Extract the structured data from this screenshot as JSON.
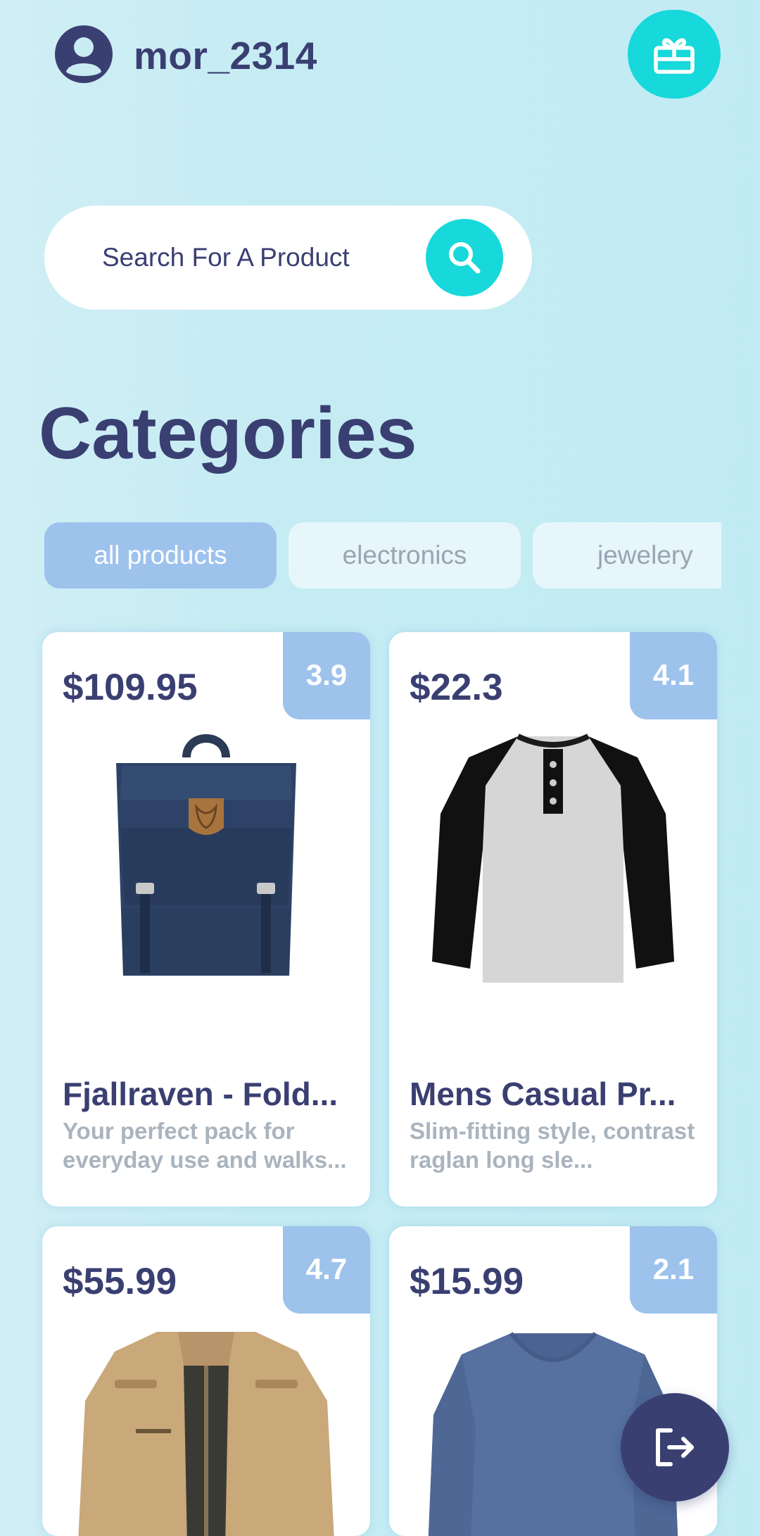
{
  "header": {
    "username": "mor_2314",
    "avatar_icon": "user-circle-icon",
    "gift_icon": "gift-icon"
  },
  "search": {
    "placeholder": "Search For A Product",
    "value": "",
    "icon": "search-icon"
  },
  "categories": {
    "title": "Categories",
    "chips": [
      {
        "label": "all products",
        "active": true
      },
      {
        "label": "electronics",
        "active": false
      },
      {
        "label": "jewelery",
        "active": false
      }
    ]
  },
  "products": [
    {
      "price": "$109.95",
      "rating": "3.9",
      "title": "Fjallraven - Fold...",
      "description": "Your perfect pack for everyday use and walks...",
      "image": "backpack-image"
    },
    {
      "price": "$22.3",
      "rating": "4.1",
      "title": "Mens Casual Pr...",
      "description": "Slim-fitting style, contrast raglan long sle...",
      "image": "henley-shirt-image"
    },
    {
      "price": "$55.99",
      "rating": "4.7",
      "title": "",
      "description": "",
      "image": "cotton-jacket-image"
    },
    {
      "price": "$15.99",
      "rating": "2.1",
      "title": "",
      "description": "",
      "image": "long-sleeve-tee-image"
    }
  ],
  "logout": {
    "icon": "logout-icon"
  },
  "colors": {
    "primary": "#3a3f72",
    "accent": "#17d8da",
    "chip_active": "#9dc2ec",
    "rating_badge": "#9dc2ec",
    "background": "#c6ecf3"
  }
}
